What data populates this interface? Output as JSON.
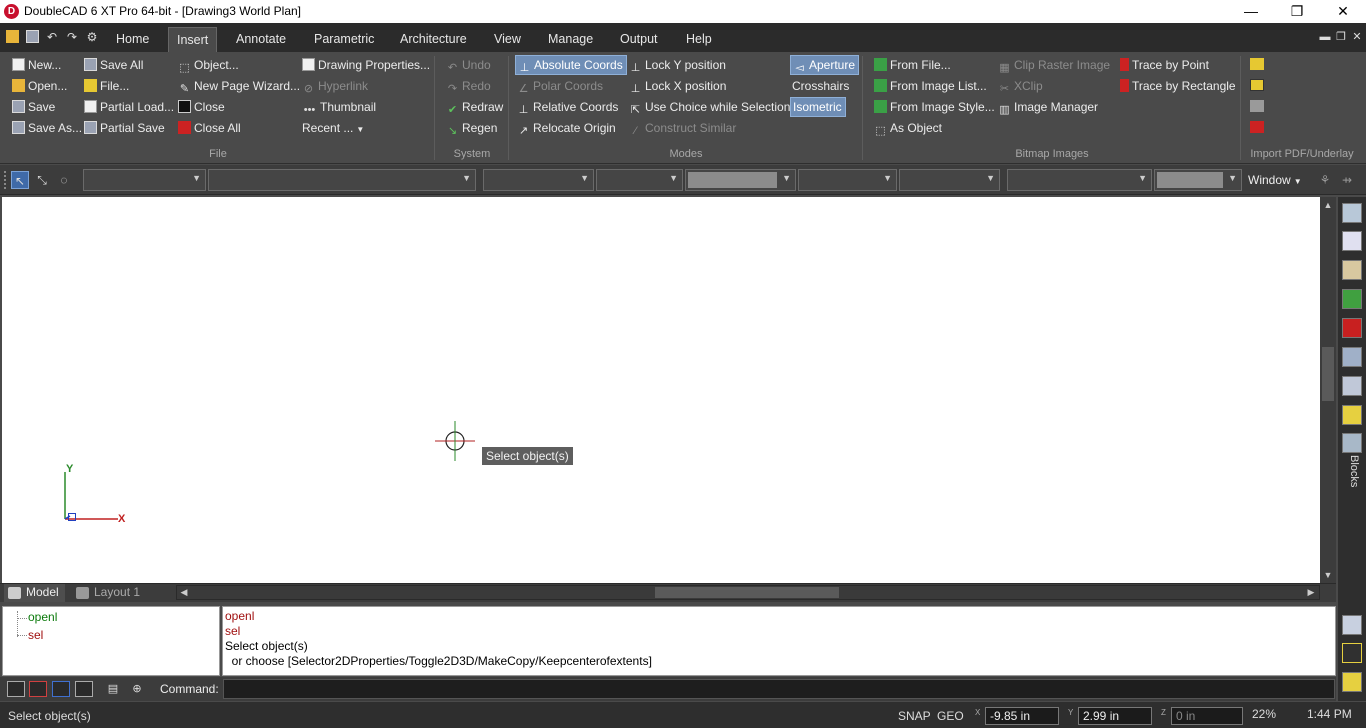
{
  "titlebar": {
    "app_icon_letter": "D",
    "title": "DoubleCAD 6 XT Pro 64-bit - [Drawing3 World Plan]",
    "minimize": "—",
    "restore": "❐",
    "close": "✕"
  },
  "menubar": {
    "items": [
      "Home",
      "Insert",
      "Annotate",
      "Parametric",
      "Architecture",
      "View",
      "Manage",
      "Output",
      "Help"
    ],
    "active": "Insert",
    "mdi": [
      "▬",
      "❐",
      "✕"
    ]
  },
  "ribbon": {
    "file": {
      "label": "File",
      "col1": [
        "New...",
        "Open...",
        "Save",
        "Save As..."
      ],
      "col2": [
        "Save All",
        "File...",
        "Partial Load...",
        "Partial Save"
      ],
      "col3": [
        "Object...",
        "New Page Wizard...",
        "Close",
        "Close All"
      ],
      "col4": [
        "Drawing Properties...",
        "Hyperlink",
        "Thumbnail",
        "Recent ..."
      ]
    },
    "system": {
      "label": "System",
      "items": [
        "Undo",
        "Redo",
        "Redraw",
        "Regen"
      ]
    },
    "modes": {
      "label": "Modes",
      "col1": [
        "Absolute Coords",
        "Polar Coords",
        "Relative Coords",
        "Relocate Origin"
      ],
      "col2": [
        "Lock Y position",
        "Lock X position",
        "Use Choice while Selection",
        "Construct Similar"
      ],
      "col3": [
        "Aperture",
        "Crosshairs",
        "Isometric"
      ]
    },
    "bitmap": {
      "label": "Bitmap Images",
      "col1": [
        "From File...",
        "From Image List...",
        "From Image Style...",
        "As Object"
      ],
      "col2": [
        "Clip Raster Image",
        "XClip",
        "Image Manager"
      ],
      "col3": [
        "Trace by Point",
        "Trace by Rectangle"
      ]
    },
    "import": {
      "label": "Import PDF/Underlay"
    }
  },
  "proptoolbar": {
    "window_label": "Window"
  },
  "canvas": {
    "tooltip": "Select object(s)",
    "axis_y": "Y",
    "axis_x": "X"
  },
  "right_panel": {
    "blocks_label": "Blocks"
  },
  "tabs": {
    "model": "Model",
    "layout1": "Layout 1"
  },
  "history": {
    "items": [
      "openl",
      "sel"
    ]
  },
  "command_log": {
    "lines": [
      "openl",
      "sel",
      "Select object(s)",
      "  or choose [Selector2DProperties/Toggle2D3D/MakeCopy/Keepcenterofextents]"
    ]
  },
  "command": {
    "label": "Command:",
    "value": ""
  },
  "statusbar": {
    "message": "Select object(s)",
    "snap": "SNAP",
    "geo": "GEO",
    "x_label": "X",
    "x_value": "-9.85 in",
    "y_label": "Y",
    "y_value": "2.99 in",
    "z_label": "Z",
    "z_value": "0 in",
    "zoom": "22%",
    "time": "1:44 PM"
  }
}
